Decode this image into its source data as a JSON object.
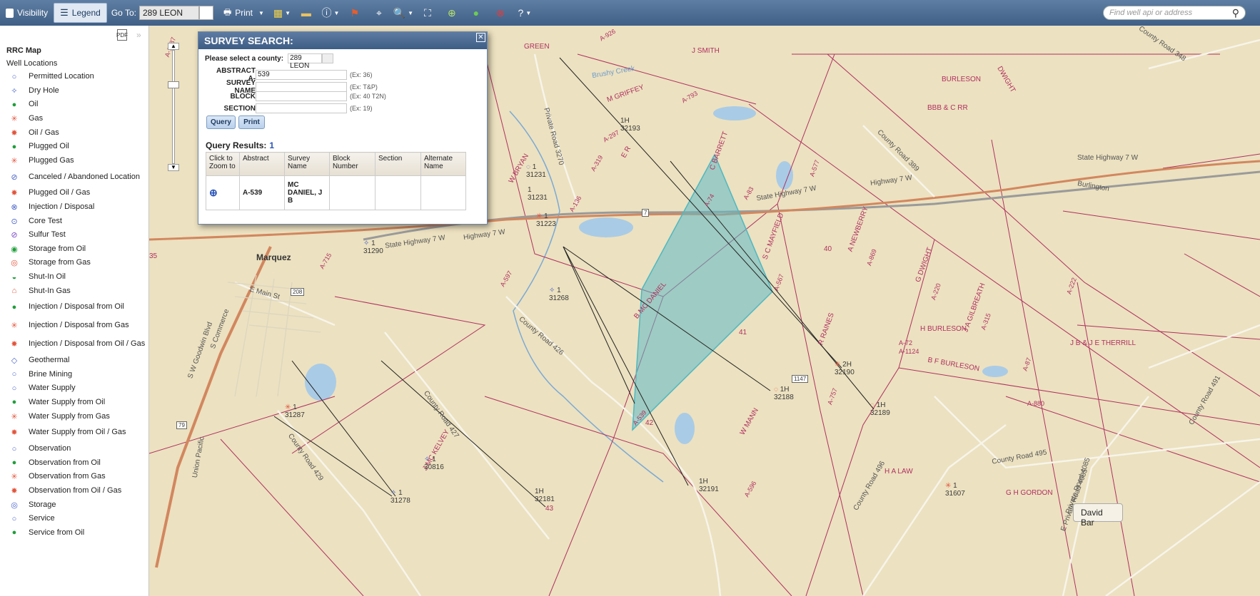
{
  "toolbar": {
    "visibility_label": "Visibility",
    "legend_label": "Legend",
    "goto_label": "Go To:",
    "goto_value": "289 LEON",
    "print_label": "Print",
    "search_placeholder": "Find well api or address"
  },
  "sidebar": {
    "map_title": "RRC Map",
    "section_title": "Well Locations",
    "items": [
      {
        "label": "Permitted Location",
        "icon": "permitted-location-icon",
        "color": "#4a63c7"
      },
      {
        "label": "Dry Hole",
        "icon": "dry-hole-icon",
        "color": "#4a63c7"
      },
      {
        "label": "Oil",
        "icon": "oil-icon",
        "color": "#1f9e3a"
      },
      {
        "label": "Gas",
        "icon": "gas-icon",
        "color": "#e2553d"
      },
      {
        "label": "Oil / Gas",
        "icon": "oil-gas-icon",
        "color": "#e2553d"
      },
      {
        "label": "Plugged Oil",
        "icon": "plugged-oil-icon",
        "color": "#1f9e3a"
      },
      {
        "label": "Plugged Gas",
        "icon": "plugged-gas-icon",
        "color": "#e2553d"
      },
      {
        "label": "Canceled / Abandoned Location",
        "icon": "canceled-location-icon",
        "color": "#4a63c7"
      },
      {
        "label": "Plugged Oil / Gas",
        "icon": "plugged-oil-gas-icon",
        "color": "#e2553d"
      },
      {
        "label": "Injection / Disposal",
        "icon": "injection-disposal-icon",
        "color": "#4a63c7"
      },
      {
        "label": "Core Test",
        "icon": "core-test-icon",
        "color": "#4a63c7"
      },
      {
        "label": "Sulfur Test",
        "icon": "sulfur-test-icon",
        "color": "#7a4ac7"
      },
      {
        "label": "Storage from Oil",
        "icon": "storage-oil-icon",
        "color": "#1f9e3a"
      },
      {
        "label": "Storage from Gas",
        "icon": "storage-gas-icon",
        "color": "#e2553d"
      },
      {
        "label": "Shut-In Oil",
        "icon": "shut-in-oil-icon",
        "color": "#1f9e3a"
      },
      {
        "label": "Shut-In Gas",
        "icon": "shut-in-gas-icon",
        "color": "#e2553d"
      },
      {
        "label": "Injection / Disposal from Oil",
        "icon": "injection-oil-icon",
        "color": "#1f9e3a"
      },
      {
        "label": "Injection / Disposal from Gas",
        "icon": "injection-gas-icon",
        "color": "#e2553d"
      },
      {
        "label": "Injection / Disposal from Oil / Gas",
        "icon": "injection-oil-gas-icon",
        "color": "#e2553d"
      },
      {
        "label": "Geothermal",
        "icon": "geothermal-icon",
        "color": "#4a63c7"
      },
      {
        "label": "Brine Mining",
        "icon": "brine-mining-icon",
        "color": "#4a63c7"
      },
      {
        "label": "Water Supply",
        "icon": "water-supply-icon",
        "color": "#4a63c7"
      },
      {
        "label": "Water Supply from Oil",
        "icon": "water-supply-oil-icon",
        "color": "#1f9e3a"
      },
      {
        "label": "Water Supply from Gas",
        "icon": "water-supply-gas-icon",
        "color": "#e2553d"
      },
      {
        "label": "Water Supply from Oil / Gas",
        "icon": "water-supply-oil-gas-icon",
        "color": "#e2553d"
      },
      {
        "label": "Observation",
        "icon": "observation-icon",
        "color": "#4a63c7"
      },
      {
        "label": "Observation from Oil",
        "icon": "observation-oil-icon",
        "color": "#1f9e3a"
      },
      {
        "label": "Observation from Gas",
        "icon": "observation-gas-icon",
        "color": "#e2553d"
      },
      {
        "label": "Observation from Oil / Gas",
        "icon": "observation-oil-gas-icon",
        "color": "#e2553d"
      },
      {
        "label": "Storage",
        "icon": "storage-icon",
        "color": "#4a63c7"
      },
      {
        "label": "Service",
        "icon": "service-icon",
        "color": "#4a63c7"
      },
      {
        "label": "Service from Oil",
        "icon": "service-oil-icon",
        "color": "#1f9e3a"
      }
    ]
  },
  "dialog": {
    "title": "SURVEY SEARCH:",
    "county_prompt": "Please select a county:",
    "county_value": "289 LEON",
    "abstract_label": "ABSTRACT A-",
    "abstract_value": "539",
    "abstract_hint": "(Ex: 36)",
    "survey_label": "SURVEY NAME",
    "survey_hint": "(Ex: T&P)",
    "block_label": "BLOCK",
    "block_hint": "(Ex: 40 T2N)",
    "section_label": "SECTION",
    "section_hint": "(Ex: 19)",
    "query_label": "Query",
    "print_label": "Print",
    "results_label": "Query Results:",
    "results_count": "1",
    "columns": [
      "Click to Zoom to",
      "Abstract",
      "Survey Name",
      "Block Number",
      "Section",
      "Alternate Name"
    ],
    "rows": [
      {
        "abstract": "A-539",
        "survey_name": "MC DANIEL, J B",
        "block": "",
        "section": "",
        "alternate": ""
      }
    ]
  },
  "map": {
    "places": [
      "Marquez"
    ],
    "roads": [
      "State Highway 7 W",
      "Highway 7 W",
      "E Main St",
      "County Road 426",
      "County Road 427",
      "County Road 429",
      "County Road 389",
      "County Road 348",
      "County Road 495",
      "County Road 496",
      "County Road 491",
      "Private Road 3270",
      "Private Road 4085",
      "E Private Road 4085",
      "S Commerce",
      "S W Goodwin Blvd",
      "Union Pacific",
      "Burlington",
      "Brushy Creek"
    ],
    "shields": [
      "208",
      "7",
      "1147",
      "79"
    ],
    "surveys": [
      "J SMITH",
      "M GRIFFEY",
      "BURLESON",
      "BBB & C RR",
      "DWIGHT",
      "C BARRETT",
      "E R",
      "A NEWBERRY",
      "S C MAYFIELD",
      "G DWIGHT",
      "J A GILBREATH",
      "H BURLESON",
      "B F BURLESON",
      "J B & J E THERRILL",
      "R RAINES",
      "B MC DANIEL",
      "J MC KELVEY",
      "W MANN",
      "H A LAW",
      "G H GORDON",
      "W BRYAN",
      "GREEN"
    ],
    "abstracts": [
      "A-926",
      "A-793",
      "A-297",
      "A-319",
      "A-136",
      "A-577",
      "A-83",
      "A-74",
      "A-715",
      "A-597",
      "A-567",
      "A-757",
      "A-539",
      "A-869",
      "A-220",
      "A-315",
      "A-222",
      "A-72",
      "A-1124",
      "A-87",
      "A-880",
      "A-1037",
      "A-596"
    ],
    "wells": [
      {
        "label": "1H",
        "id": "32193"
      },
      {
        "label": "1",
        "id": "31231"
      },
      {
        "label": "1",
        "id": "31231"
      },
      {
        "label": "1",
        "id": "31223"
      },
      {
        "label": "1",
        "id": "31290"
      },
      {
        "label": "1",
        "id": "31268"
      },
      {
        "label": "2H",
        "id": "32190"
      },
      {
        "label": "1H",
        "id": "32188"
      },
      {
        "label": "1H",
        "id": "32189"
      },
      {
        "label": "1",
        "id": "31287"
      },
      {
        "label": "1",
        "id": "30816"
      },
      {
        "label": "1",
        "id": "31278"
      },
      {
        "label": "1H",
        "id": "32181"
      },
      {
        "label": "1H",
        "id": "32191"
      },
      {
        "label": "1",
        "id": "31607"
      }
    ],
    "numbers": [
      "40",
      "41",
      "42",
      "43",
      "35"
    ],
    "user_button": "David Bar"
  },
  "colors": {
    "toolbar": "#4a6a92",
    "survey_polygon": "#4fb8c0",
    "survey_line": "#b03060",
    "highway": "#d2875f"
  }
}
